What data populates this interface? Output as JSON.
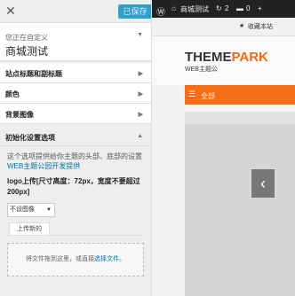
{
  "sidebar": {
    "saved_label": "已保存",
    "customizing_label": "您正在自定义",
    "site_title": "商城测试",
    "sections": [
      {
        "label": "站点标题和副标题"
      },
      {
        "label": "颜色"
      },
      {
        "label": "背景图像"
      }
    ],
    "open_section": {
      "label": "初始化设置选项",
      "description_text": "这个选项提供给你主题的头部、底部的设置",
      "description_link": "WEB主题公园开发提供",
      "logo_label": "logo上传[尺寸高度：72px，宽度不要超过200px]",
      "no_image_option": "不设图像",
      "upload_tab": "上传新的",
      "dropzone_text": "将文件拖到这里，或直接",
      "dropzone_link": "选择文件",
      "dropzone_end": "。"
    }
  },
  "preview": {
    "adminbar": {
      "site_name": "商城测试",
      "updates_count": "2",
      "comments_count": "0",
      "new_symbol": "+"
    },
    "bookmark_label": "收藏本站",
    "logo_main": "THEME",
    "logo_accent": "PARK",
    "logo_sub": "WEB主题公",
    "nav_label": "全部"
  },
  "colors": {
    "accent_blue": "#2ea2cc",
    "nav_orange": "#f56f1a",
    "adminbar": "#222222"
  }
}
